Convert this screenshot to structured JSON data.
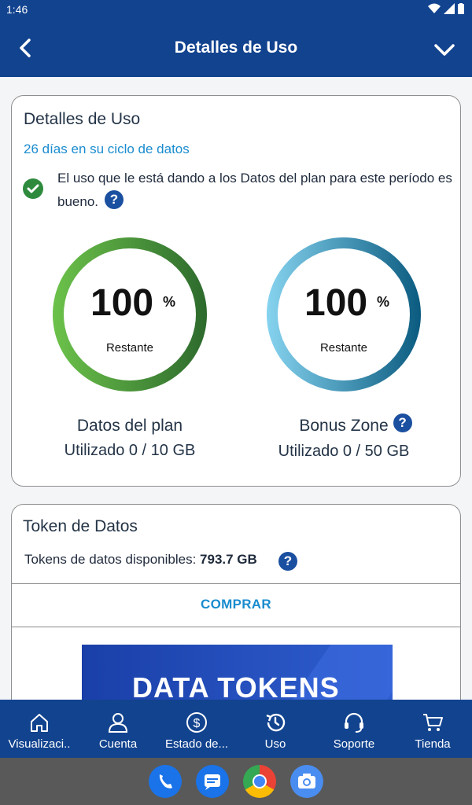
{
  "status_bar": {
    "time": "1:46"
  },
  "app_bar": {
    "title": "Detalles de Uso"
  },
  "usage_card": {
    "title": "Detalles de Uso",
    "cycle_text": "26 días en su ciclo de datos",
    "usage_message": "El uso que le está dando a los Datos del plan para este período es bueno.",
    "help_icon": "question-icon",
    "plan_meter": {
      "value": "100",
      "unit": "%",
      "caption": "Restante",
      "name": "Datos del plan",
      "used": "Utilizado 0 / 10 GB",
      "color_start": "#6cc24a",
      "color_end": "#2d6a2d"
    },
    "bonus_meter": {
      "value": "100",
      "unit": "%",
      "caption": "Restante",
      "name": "Bonus Zone",
      "used": "Utilizado 0 / 50 GB",
      "color_start": "#86d3ef",
      "color_end": "#0b5b80"
    }
  },
  "token_card": {
    "title": "Token de Datos",
    "available_label": "Tokens de datos disponibles:",
    "available_value": "793.7 GB",
    "buy_label": "COMPRAR",
    "banner_text": "DATA TOKENS"
  },
  "bottom_nav": {
    "items": [
      {
        "label": "Visualizaci..",
        "icon": "home-icon"
      },
      {
        "label": "Cuenta",
        "icon": "person-icon"
      },
      {
        "label": "Estado de...",
        "icon": "dollar-icon"
      },
      {
        "label": "Uso",
        "icon": "history-icon"
      },
      {
        "label": "Soporte",
        "icon": "headset-icon"
      },
      {
        "label": "Tienda",
        "icon": "cart-icon"
      }
    ]
  },
  "dock": [
    "phone-icon",
    "messages-icon",
    "chrome-icon",
    "camera-icon"
  ],
  "colors": {
    "primary": "#12438f",
    "accent": "#1a8ccf",
    "success": "#2e8b3e"
  }
}
